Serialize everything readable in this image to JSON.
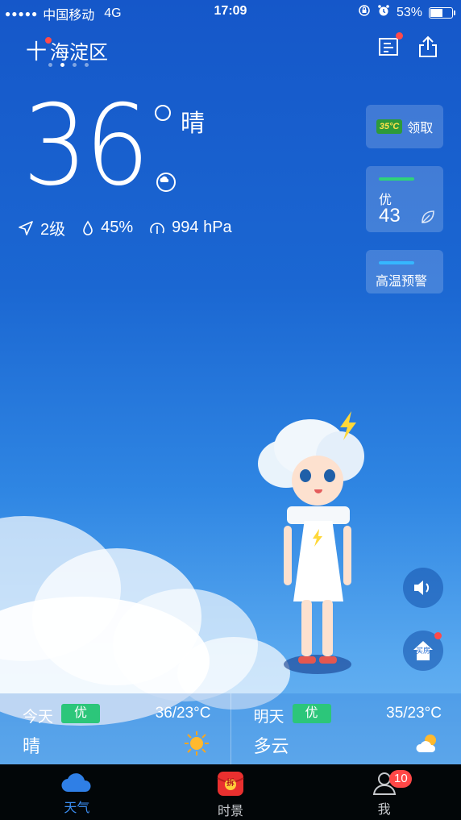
{
  "status_bar": {
    "carrier": "中国移动",
    "network": "4G",
    "time": "17:09",
    "battery": "53%"
  },
  "header": {
    "city": "海淀区",
    "add_symbol": "十",
    "page_dots": 4,
    "active_page": 2
  },
  "weather": {
    "temperature": "36",
    "condition": "晴",
    "wind": "2级",
    "humidity": "45%",
    "pressure": "994 hPa"
  },
  "side_cards": {
    "red_packet": {
      "badge_text": "35°C",
      "label": "领取"
    },
    "aqi": {
      "level": "优",
      "value": "43",
      "bar_color": "#2fd27a"
    },
    "warning": {
      "label": "高温预警",
      "bar_color": "#35b7ff"
    }
  },
  "buttons": {
    "house_label": "买房"
  },
  "forecast": [
    {
      "day": "今天",
      "quality": "优",
      "range": "36/23°C",
      "condition": "晴",
      "icon": "sun-icon"
    },
    {
      "day": "明天",
      "quality": "优",
      "range": "35/23°C",
      "condition": "多云",
      "icon": "partly-cloudy-icon"
    }
  ],
  "tabbar": {
    "items": [
      {
        "label": "天气",
        "icon": "cloud-icon",
        "active": true
      },
      {
        "label": "时景",
        "icon": "red-packet-icon",
        "badge_text": "拆"
      },
      {
        "label": "我",
        "icon": "user-icon",
        "badge": "10"
      }
    ]
  },
  "colors": {
    "quality_green": "#2cc67a",
    "accent_blue": "#3b8ef2",
    "badge_red": "#ff4747"
  }
}
